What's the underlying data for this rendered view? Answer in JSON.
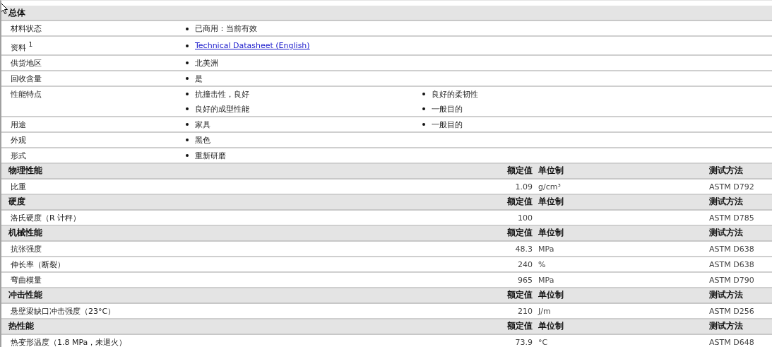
{
  "sections": [
    {
      "kind": "general",
      "title": "总体",
      "rows": [
        {
          "label": "材料状态",
          "items": [
            {
              "kind": "text",
              "text": "已商用：当前有效"
            }
          ]
        },
        {
          "label": "资料 $^{1}$",
          "items": [
            {
              "kind": "link",
              "text": "Technical Datasheet (English)"
            }
          ]
        },
        {
          "label": "供货地区",
          "items": [
            {
              "kind": "text",
              "text": "北美洲"
            }
          ]
        },
        {
          "label": "回收含量",
          "items": [
            {
              "kind": "text",
              "text": "是"
            }
          ]
        },
        {
          "label": "性能特点",
          "items": [
            {
              "kind": "text",
              "text": "抗撞击性，良好"
            },
            {
              "kind": "text",
              "text": "良好的柔韧性"
            },
            {
              "kind": "text",
              "text": "良好的成型性能"
            },
            {
              "kind": "text",
              "text": "一般目的"
            }
          ]
        },
        {
          "label": "用途",
          "items": [
            {
              "kind": "text",
              "text": "家具"
            },
            {
              "kind": "text",
              "text": "一般目的"
            }
          ]
        },
        {
          "label": "外观",
          "items": [
            {
              "kind": "text",
              "text": "黑色"
            }
          ]
        },
        {
          "label": "形式",
          "items": [
            {
              "kind": "text",
              "text": "重新研磨"
            }
          ]
        }
      ]
    },
    {
      "kind": "data",
      "title": "物理性能",
      "columns": [
        "额定值",
        "单位制",
        "测试方法"
      ],
      "rows": [
        {
          "label": "比重",
          "value": "1.09",
          "unit": "g/cm³",
          "method": "ASTM D792"
        }
      ]
    },
    {
      "kind": "data",
      "title": "硬度",
      "columns": [
        "额定值",
        "单位制",
        "测试方法"
      ],
      "rows": [
        {
          "label": "洛氏硬度（R 计秤）",
          "value": "100",
          "method": "ASTM D785"
        }
      ]
    },
    {
      "kind": "data",
      "title": "机械性能",
      "columns": [
        "额定值",
        "单位制",
        "测试方法"
      ],
      "rows": [
        {
          "label": "抗张强度",
          "value": "48.3",
          "unit": "MPa",
          "method": "ASTM D638"
        },
        {
          "label": "伸长率（断裂）",
          "value": "240",
          "unit": "%",
          "method": "ASTM D638"
        },
        {
          "label": "弯曲模量",
          "value": "965",
          "unit": "MPa",
          "method": "ASTM D790"
        }
      ]
    },
    {
      "kind": "data",
      "title": "冲击性能",
      "columns": [
        "额定值",
        "单位制",
        "测试方法"
      ],
      "rows": [
        {
          "label": "悬壁梁缺口冲击强度（23°C）",
          "value": "210",
          "unit": "J/m",
          "method": "ASTM D256"
        }
      ]
    },
    {
      "kind": "data",
      "title": "热性能",
      "columns": [
        "额定值",
        "单位制",
        "测试方法"
      ],
      "rows": [
        {
          "label": "热变形温度（1.8 MPa，未退火）",
          "value": "73.9",
          "unit": "°C",
          "method": "ASTM D648"
        }
      ]
    }
  ]
}
